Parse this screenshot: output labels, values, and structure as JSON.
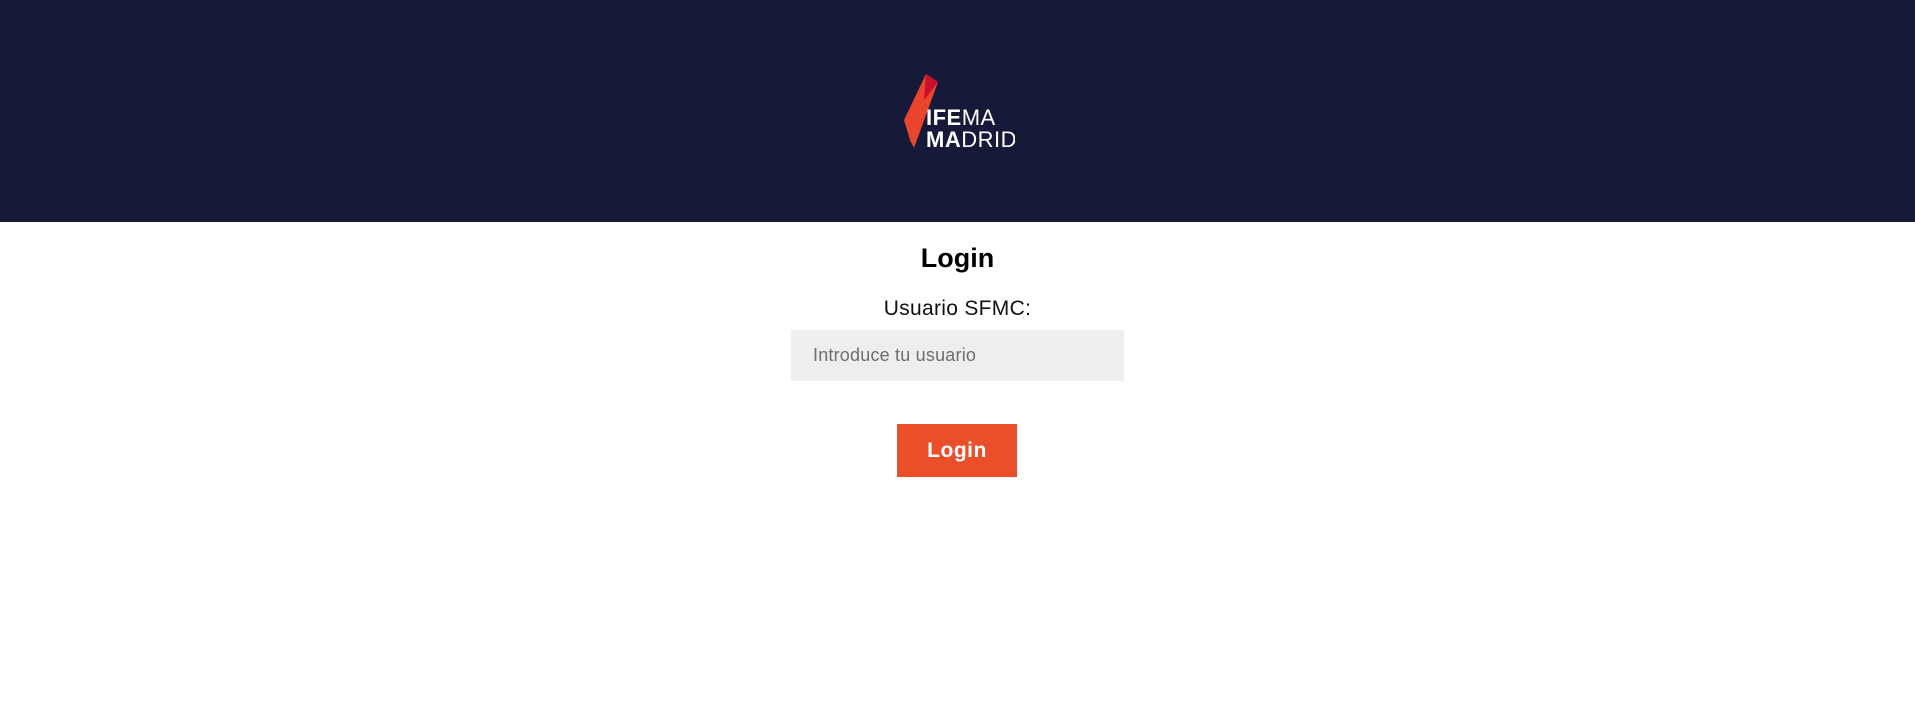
{
  "header": {
    "background_color": "#171939",
    "logo": {
      "line1_bold": "IFE",
      "line1_light": "MA",
      "line2_bold": "MA",
      "line2_light": "DRID",
      "icon": "ifema-flame-logo-icon",
      "accent_colors": [
        "#e8452c",
        "#c8102e"
      ]
    }
  },
  "login": {
    "title": "Login",
    "username_label": "Usuario SFMC:",
    "username_value": "",
    "username_placeholder": "Introduce tu usuario",
    "submit_label": "Login",
    "button_color": "#ea4f2a"
  }
}
